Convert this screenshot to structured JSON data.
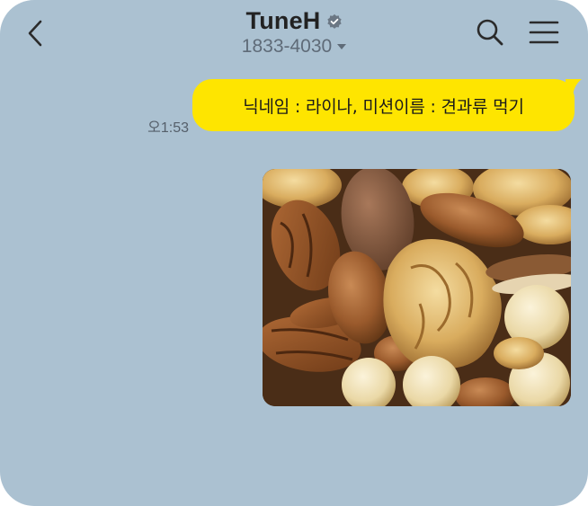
{
  "header": {
    "title": "TuneH",
    "subtitle": "1833-4030"
  },
  "messages": [
    {
      "type": "text",
      "time": "오1:53",
      "text": "닉네임 : 라이나, 미션이름 :  견과류 먹기"
    },
    {
      "type": "image",
      "image_subject": "mixed-nuts-photo"
    }
  ],
  "colors": {
    "chat_background": "#abc1d1",
    "bubble_me": "#fee500",
    "title": "#222222",
    "subtitle": "#5f6b78"
  },
  "icons": [
    "back-arrow-icon",
    "verified-badge-icon",
    "dropdown-caret-icon",
    "search-icon",
    "menu-icon"
  ]
}
